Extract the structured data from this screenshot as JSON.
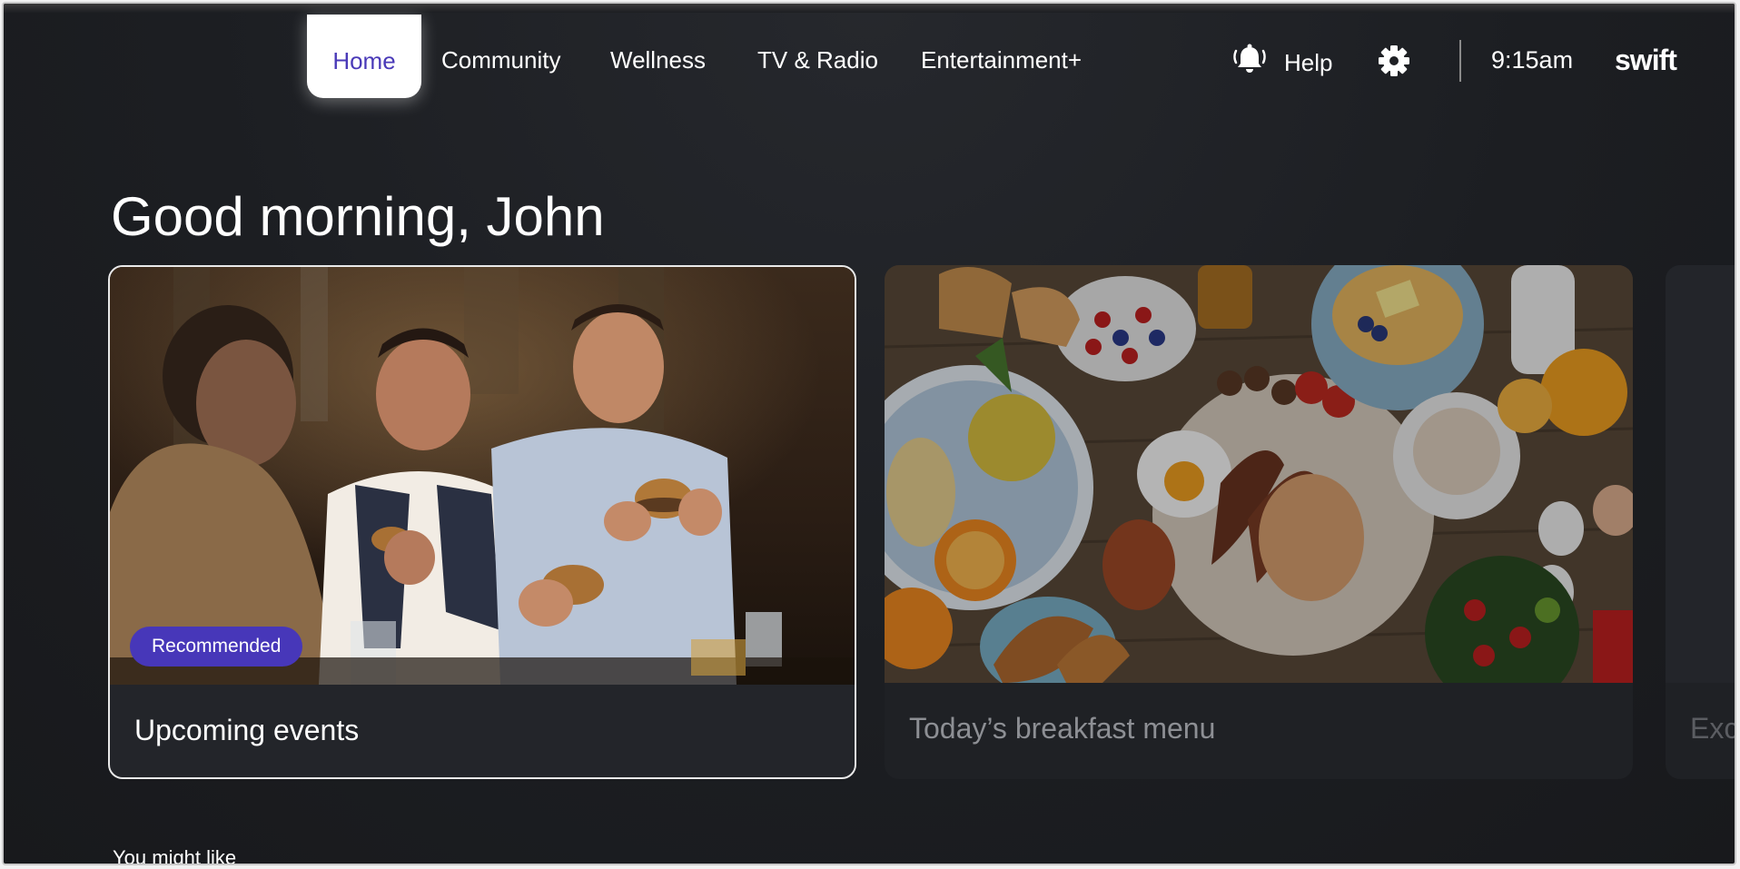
{
  "nav": {
    "items": [
      {
        "label": "Home",
        "active": true
      },
      {
        "label": "Community"
      },
      {
        "label": "Wellness"
      },
      {
        "label": "TV & Radio"
      },
      {
        "label": "Entertainment+"
      }
    ],
    "help_label": "Help",
    "bell_icon": "bell-ringing-icon",
    "settings_icon": "gear-icon",
    "time": "9:15am",
    "logo": "swift"
  },
  "greeting": "Good morning, John",
  "cards": [
    {
      "title": "Upcoming events",
      "badge": "Recommended",
      "image": "friends-eating-burgers-photo",
      "focused": true
    },
    {
      "title": "Today’s breakfast menu",
      "image": "breakfast-table-photo"
    },
    {
      "title": "Exc",
      "image": "partial-card-photo"
    }
  ],
  "section": {
    "title": "You might like"
  },
  "colors": {
    "accent": "#4737b9",
    "home_text": "#4a3ab8",
    "background": "#1c1e22"
  }
}
